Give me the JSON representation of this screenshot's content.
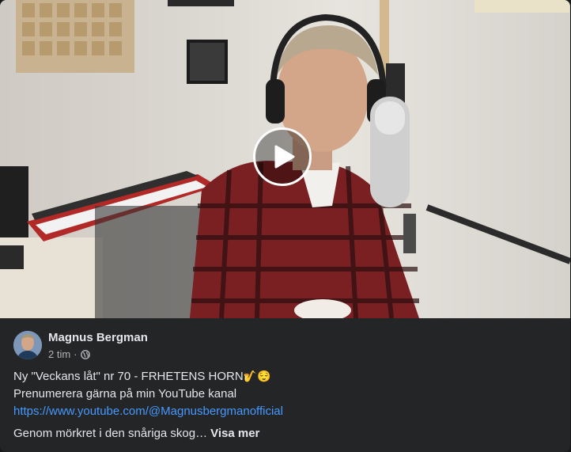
{
  "video": {
    "thumbnail": "man-singing-at-microphone-with-headphones",
    "play_icon": "play-icon"
  },
  "post": {
    "author": "Magnus Bergman",
    "time": "2 tim",
    "separator": "·",
    "audience_icon": "globe-icon",
    "line1": "Ny \"Veckans låt\" nr 70 - FRHETENS HORN",
    "line1_emoji": "🎷😌",
    "line2": "Prenumerera gärna på min YouTube kanal",
    "link": "https://www.youtube.com/@Magnusbergmanofficial",
    "preview": "Genom mörkret i den snåriga skog…",
    "see_more": "Visa mer"
  },
  "colors": {
    "card_bg": "#242526",
    "link": "#4599ff",
    "secondary_text": "#b0b3b8"
  }
}
